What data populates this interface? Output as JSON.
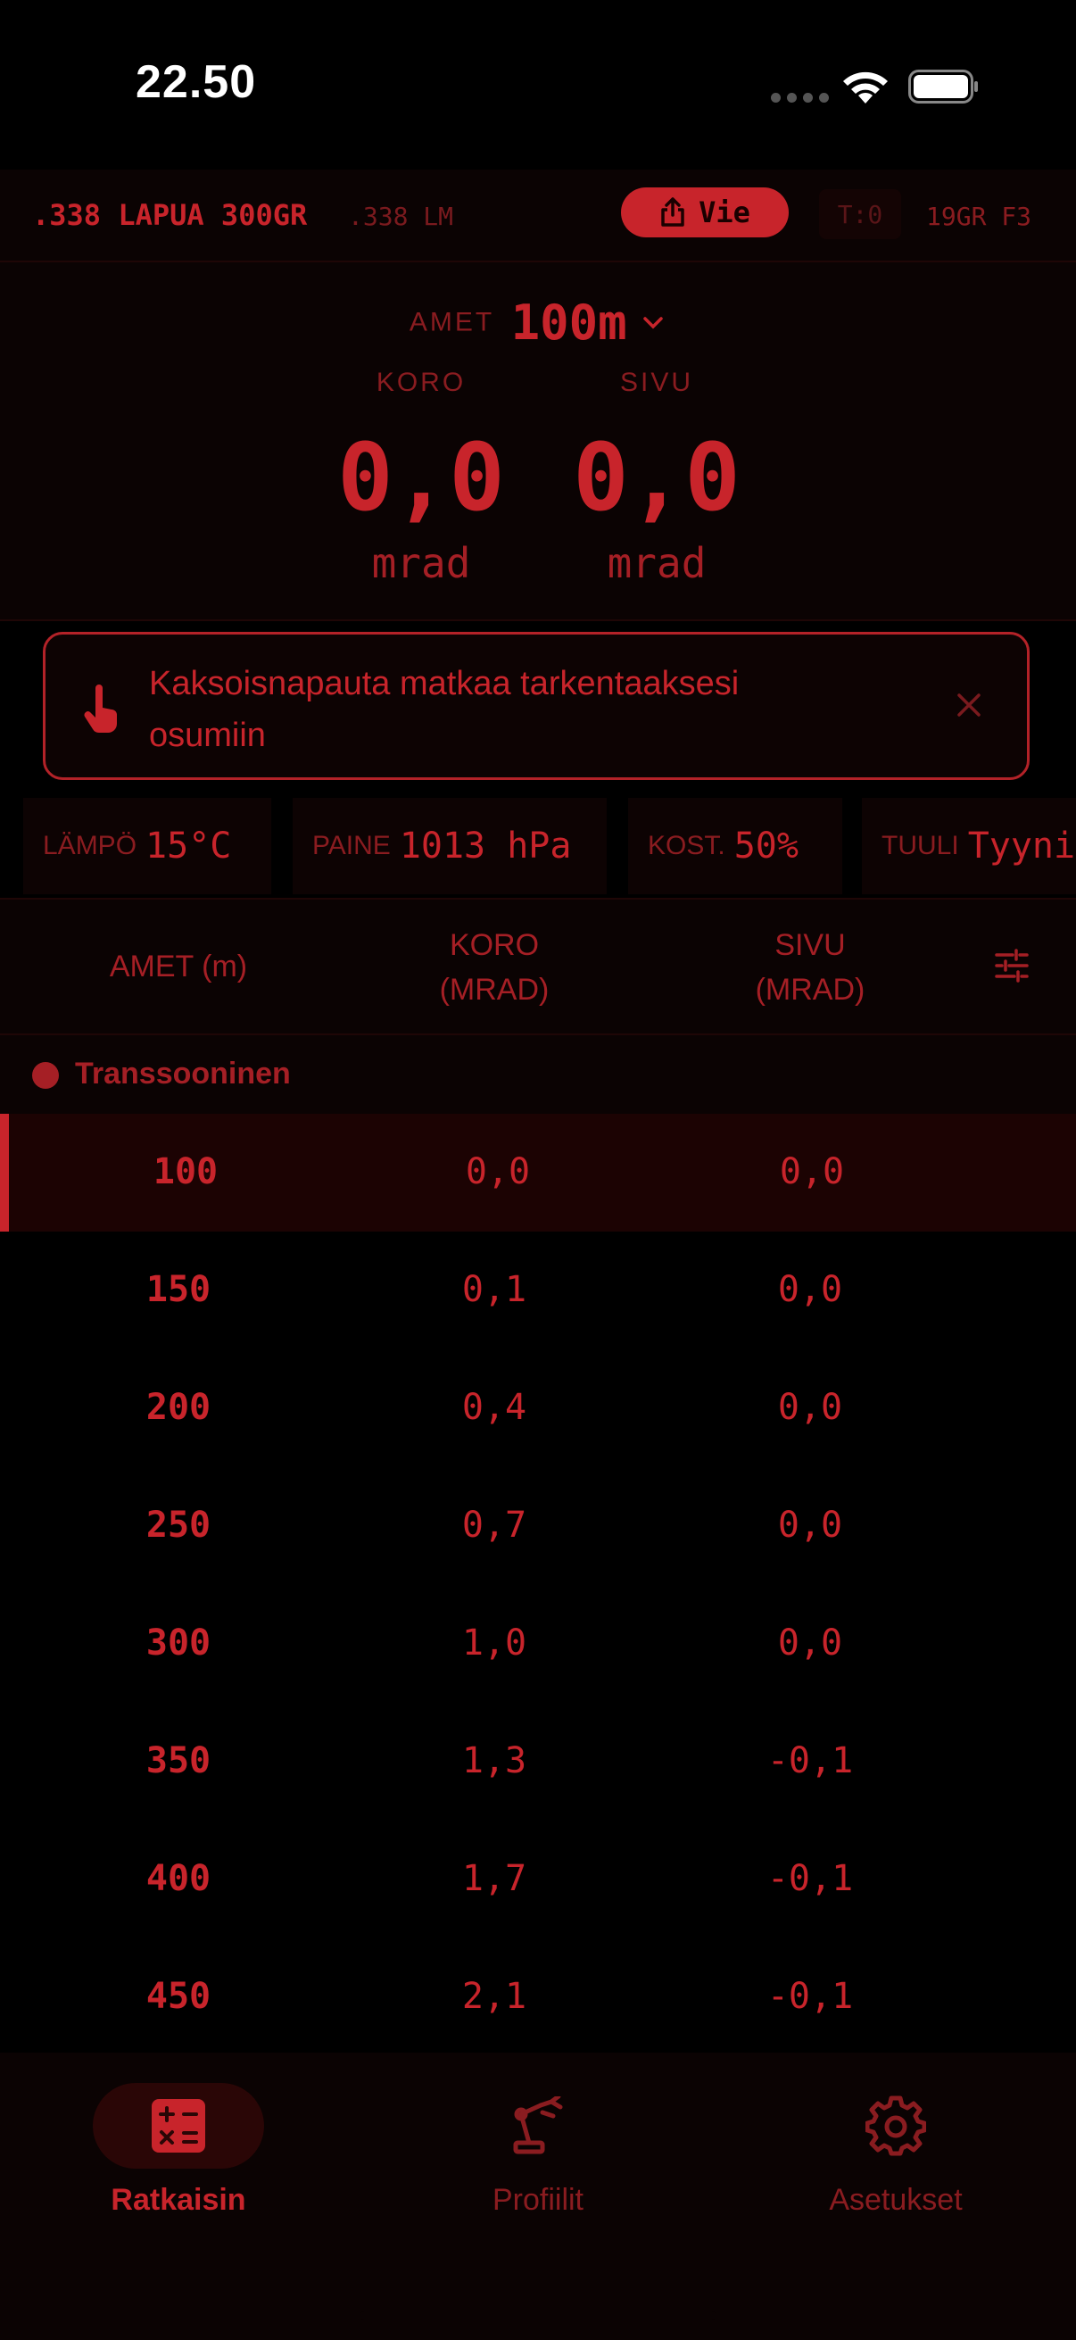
{
  "status": {
    "time": "22.50"
  },
  "profile": {
    "name": ".338 LAPUA 300GR",
    "caliber": ".338 LM",
    "export_label": "Vie",
    "target_label": "T:0",
    "bullet": "19GR F3"
  },
  "readout": {
    "distance_label": "AMET",
    "distance_value": "100m",
    "elev_label": "KORO",
    "wind_label": "SIVU",
    "elev_value": "0,0",
    "wind_value": "0,0",
    "elev_unit": "mrad",
    "wind_unit": "mrad"
  },
  "hint": {
    "text": "Kaksoisnapauta matkaa tarkentaaksesi osumiin"
  },
  "conditions": [
    {
      "key": "LÄMPÖ",
      "value": "15°C"
    },
    {
      "key": "PAINE",
      "value": "1013 hPa"
    },
    {
      "key": "KOST.",
      "value": "50%"
    },
    {
      "key": "TUULI",
      "value": "Tyyni"
    }
  ],
  "table": {
    "headers": [
      "AMET (m)",
      "KORO\n(MRAD)",
      "SIVU\n(MRAD)"
    ],
    "group": "Transsooninen",
    "rows": [
      {
        "d": "100",
        "e": "0,0",
        "w": "0,0"
      },
      {
        "d": "150",
        "e": "0,1",
        "w": "0,0"
      },
      {
        "d": "200",
        "e": "0,4",
        "w": "0,0"
      },
      {
        "d": "250",
        "e": "0,7",
        "w": "0,0"
      },
      {
        "d": "300",
        "e": "1,0",
        "w": "0,0"
      },
      {
        "d": "350",
        "e": "1,3",
        "w": "-0,1"
      },
      {
        "d": "400",
        "e": "1,7",
        "w": "-0,1"
      },
      {
        "d": "450",
        "e": "2,1",
        "w": "-0,1"
      }
    ]
  },
  "tabs": [
    {
      "label": "Ratkaisin",
      "icon": "calculator-icon",
      "active": true
    },
    {
      "label": "Profiilit",
      "icon": "robot-arm-icon",
      "active": false
    },
    {
      "label": "Asetukset",
      "icon": "gear-icon",
      "active": false
    }
  ],
  "colors": {
    "accent": "#c8242b",
    "dim": "#8a1c20",
    "bg": "#000000"
  }
}
